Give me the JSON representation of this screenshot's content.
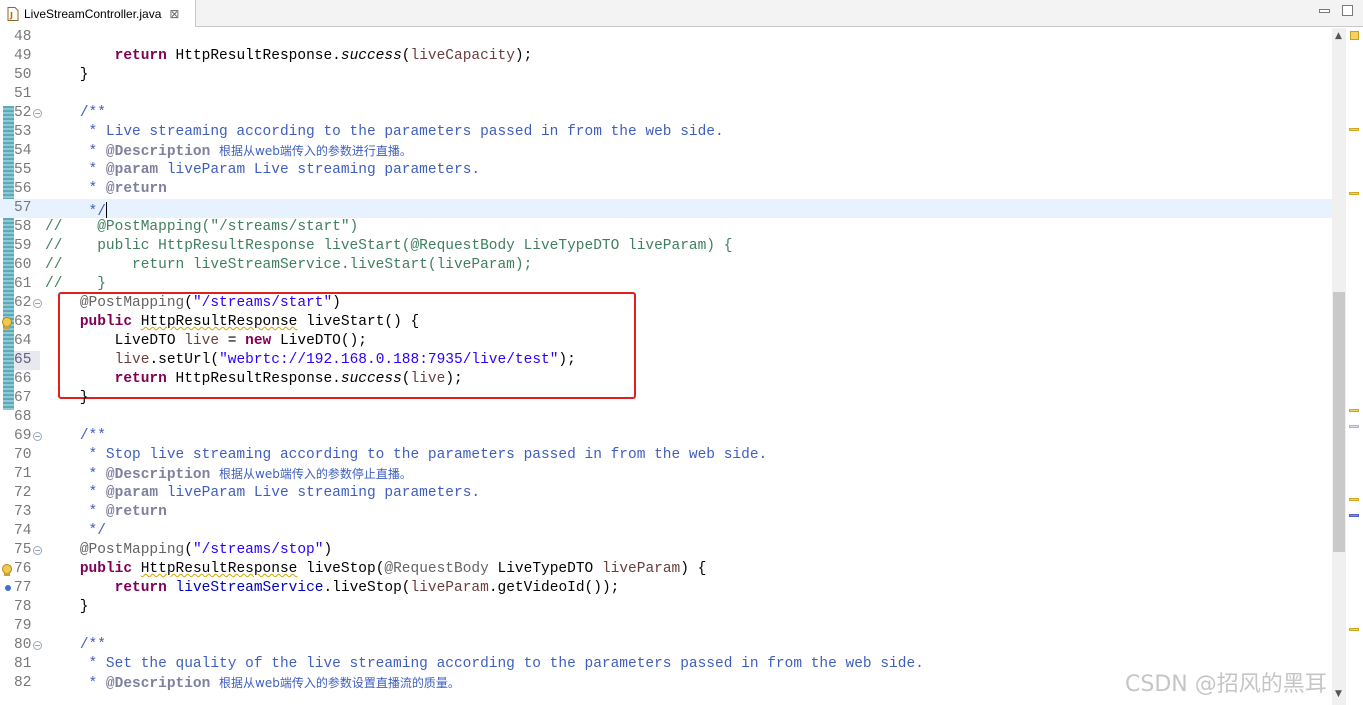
{
  "tab": {
    "title": "LiveStreamController.java",
    "close_glyph": "⊠",
    "icon": "java-file-icon"
  },
  "window_buttons": {
    "minimize": "minimize-icon",
    "maximize": "maximize-icon"
  },
  "lines": [
    {
      "n": "48",
      "tokens": []
    },
    {
      "n": "49",
      "tokens": [
        {
          "t": "        "
        },
        {
          "t": "return",
          "c": "kw"
        },
        {
          "t": " HttpResultResponse."
        },
        {
          "t": "success",
          "c": "it"
        },
        {
          "t": "("
        },
        {
          "t": "liveCapacity",
          "c": "var"
        },
        {
          "t": ");"
        }
      ]
    },
    {
      "n": "50",
      "tokens": [
        {
          "t": "    }"
        }
      ]
    },
    {
      "n": "51",
      "tokens": []
    },
    {
      "n": "52",
      "tokens": [
        {
          "t": "    "
        },
        {
          "t": "/**",
          "c": "jd"
        }
      ]
    },
    {
      "n": "53",
      "tokens": [
        {
          "t": "     * Live streaming according to the parameters passed in from the web side.",
          "c": "jd"
        }
      ]
    },
    {
      "n": "54",
      "tokens": [
        {
          "t": "     * ",
          "c": "jd"
        },
        {
          "t": "@Description",
          "c": "jt"
        },
        {
          "t": " ",
          "c": "jd"
        },
        {
          "t": "根据从web端传入的参数进行直播。",
          "c": "jd cjk"
        }
      ]
    },
    {
      "n": "55",
      "tokens": [
        {
          "t": "     * ",
          "c": "jd"
        },
        {
          "t": "@param",
          "c": "jt"
        },
        {
          "t": " liveParam Live streaming parameters.",
          "c": "jd"
        }
      ]
    },
    {
      "n": "56",
      "tokens": [
        {
          "t": "     * ",
          "c": "jd"
        },
        {
          "t": "@return",
          "c": "jt"
        }
      ]
    },
    {
      "n": "57",
      "tokens": [
        {
          "t": "     */",
          "c": "jd"
        }
      ],
      "current": true
    },
    {
      "n": "58",
      "tokens": [
        {
          "t": "//    @PostMapping(\"/streams/start\")",
          "c": "cm"
        }
      ]
    },
    {
      "n": "59",
      "tokens": [
        {
          "t": "//    public HttpResultResponse liveStart(@RequestBody LiveTypeDTO liveParam) {",
          "c": "cm"
        }
      ]
    },
    {
      "n": "60",
      "tokens": [
        {
          "t": "//        return liveStreamService.liveStart(liveParam);",
          "c": "cm"
        }
      ]
    },
    {
      "n": "61",
      "tokens": [
        {
          "t": "//    }",
          "c": "cm"
        }
      ]
    },
    {
      "n": "62",
      "tokens": [
        {
          "t": "    "
        },
        {
          "t": "@PostMapping",
          "c": "an"
        },
        {
          "t": "("
        },
        {
          "t": "\"/streams/start\"",
          "c": "st"
        },
        {
          "t": ")"
        }
      ]
    },
    {
      "n": "63",
      "tokens": [
        {
          "t": "    "
        },
        {
          "t": "public",
          "c": "kw"
        },
        {
          "t": " "
        },
        {
          "t": "HttpResultResponse",
          "c": "warnul"
        },
        {
          "t": " liveStart() {"
        }
      ]
    },
    {
      "n": "64",
      "tokens": [
        {
          "t": "        LiveDTO "
        },
        {
          "t": "live",
          "c": "var"
        },
        {
          "t": " = "
        },
        {
          "t": "new",
          "c": "kw"
        },
        {
          "t": " LiveDTO();"
        }
      ]
    },
    {
      "n": "65",
      "tokens": [
        {
          "t": "        "
        },
        {
          "t": "live",
          "c": "var"
        },
        {
          "t": ".setUrl("
        },
        {
          "t": "\"webrtc://192.168.0.188:7935/live/test\"",
          "c": "st"
        },
        {
          "t": ");"
        }
      ]
    },
    {
      "n": "66",
      "tokens": [
        {
          "t": "        "
        },
        {
          "t": "return",
          "c": "kw"
        },
        {
          "t": " HttpResultResponse."
        },
        {
          "t": "success",
          "c": "it"
        },
        {
          "t": "("
        },
        {
          "t": "live",
          "c": "var"
        },
        {
          "t": ");"
        }
      ]
    },
    {
      "n": "67",
      "tokens": [
        {
          "t": "    }"
        }
      ]
    },
    {
      "n": "68",
      "tokens": []
    },
    {
      "n": "69",
      "tokens": [
        {
          "t": "    "
        },
        {
          "t": "/**",
          "c": "jd"
        }
      ]
    },
    {
      "n": "70",
      "tokens": [
        {
          "t": "     * Stop live streaming according to the parameters passed in from the web side.",
          "c": "jd"
        }
      ]
    },
    {
      "n": "71",
      "tokens": [
        {
          "t": "     * ",
          "c": "jd"
        },
        {
          "t": "@Description",
          "c": "jt"
        },
        {
          "t": " ",
          "c": "jd"
        },
        {
          "t": "根据从web端传入的参数停止直播。",
          "c": "jd cjk"
        }
      ]
    },
    {
      "n": "72",
      "tokens": [
        {
          "t": "     * ",
          "c": "jd"
        },
        {
          "t": "@param",
          "c": "jt"
        },
        {
          "t": " liveParam Live streaming parameters.",
          "c": "jd"
        }
      ]
    },
    {
      "n": "73",
      "tokens": [
        {
          "t": "     * ",
          "c": "jd"
        },
        {
          "t": "@return",
          "c": "jt"
        }
      ]
    },
    {
      "n": "74",
      "tokens": [
        {
          "t": "     */",
          "c": "jd"
        }
      ]
    },
    {
      "n": "75",
      "tokens": [
        {
          "t": "    "
        },
        {
          "t": "@PostMapping",
          "c": "an"
        },
        {
          "t": "("
        },
        {
          "t": "\"/streams/stop\"",
          "c": "st"
        },
        {
          "t": ")"
        }
      ]
    },
    {
      "n": "76",
      "tokens": [
        {
          "t": "    "
        },
        {
          "t": "public",
          "c": "kw"
        },
        {
          "t": " "
        },
        {
          "t": "HttpResultResponse",
          "c": "warnul"
        },
        {
          "t": " liveStop("
        },
        {
          "t": "@RequestBody",
          "c": "an"
        },
        {
          "t": " LiveTypeDTO "
        },
        {
          "t": "liveParam",
          "c": "var"
        },
        {
          "t": ") {"
        }
      ]
    },
    {
      "n": "77",
      "tokens": [
        {
          "t": "        "
        },
        {
          "t": "return",
          "c": "kw"
        },
        {
          "t": " "
        },
        {
          "t": "liveStreamService",
          "c": "fd"
        },
        {
          "t": ".liveStop("
        },
        {
          "t": "liveParam",
          "c": "var"
        },
        {
          "t": ".getVideoId());"
        }
      ]
    },
    {
      "n": "78",
      "tokens": [
        {
          "t": "    }"
        }
      ]
    },
    {
      "n": "79",
      "tokens": []
    },
    {
      "n": "80",
      "tokens": [
        {
          "t": "    "
        },
        {
          "t": "/**",
          "c": "jd"
        }
      ]
    },
    {
      "n": "81",
      "tokens": [
        {
          "t": "     * Set the quality of the live streaming according to the parameters passed in from the web side.",
          "c": "jd"
        }
      ]
    },
    {
      "n": "82",
      "tokens": [
        {
          "t": "     * ",
          "c": "jd"
        },
        {
          "t": "@Description",
          "c": "jt"
        },
        {
          "t": " ",
          "c": "jd"
        },
        {
          "t": "根据从web端传入的参数设置直播流的质量。",
          "c": "jd cjk"
        }
      ]
    }
  ],
  "fold_lines": [
    "52",
    "62",
    "69",
    "75",
    "80"
  ],
  "warning_lines": [
    "63",
    "76"
  ],
  "override_lines": [
    "77"
  ],
  "highlighted_line_number": "65",
  "watermark": "CSDN @招风的黑耳"
}
